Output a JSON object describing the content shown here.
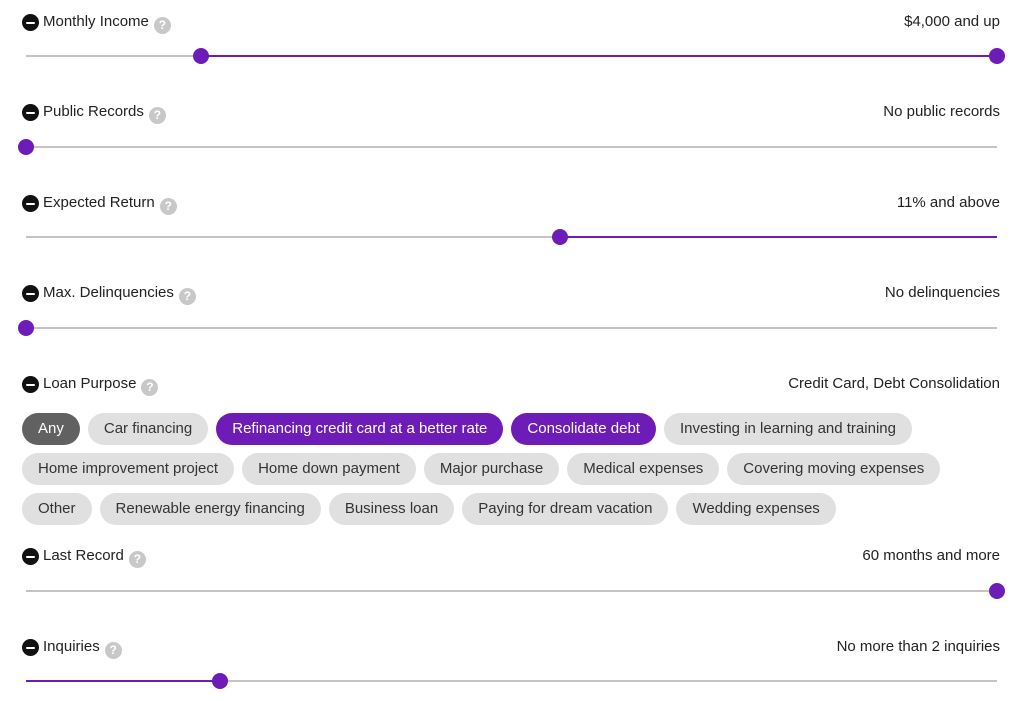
{
  "filters": {
    "monthly_income": {
      "label": "Monthly Income",
      "value": "$4,000 and up",
      "range": [
        0.18,
        1.0
      ]
    },
    "public_records": {
      "label": "Public Records",
      "value": "No public records",
      "range": [
        0.0,
        0.0
      ]
    },
    "expected_return": {
      "label": "Expected Return",
      "value": "11% and above",
      "range": [
        0.55,
        1.0
      ]
    },
    "max_delinquencies": {
      "label": "Max. Delinquencies",
      "value": "No delinquencies",
      "range": [
        0.0,
        0.0
      ]
    },
    "loan_purpose": {
      "label": "Loan Purpose",
      "value": "Credit Card, Debt Consolidation"
    },
    "last_record": {
      "label": "Last Record",
      "value": "60 months and more",
      "range": [
        1.0,
        1.0
      ]
    },
    "inquiries": {
      "label": "Inquiries",
      "value": "No more than 2 inquiries",
      "range": [
        0.0,
        0.2
      ]
    }
  },
  "help_glyph": "?",
  "chips": [
    [
      "Any",
      "Car financing",
      "Refinancing credit card at a better rate",
      "Consolidate debt",
      "Investing in learning and training"
    ],
    [
      "Home improvement project",
      "Home down payment",
      "Major purchase",
      "Medical expenses",
      "Covering moving expenses"
    ],
    [
      "Other",
      "Renewable energy financing",
      "Business loan",
      "Paying for dream vacation",
      "Wedding expenses"
    ]
  ],
  "selected_chips": [
    "Refinancing credit card at a better rate",
    "Consolidate debt"
  ],
  "colors": {
    "accent": "#6e1cb8",
    "track": "#c4c4c4",
    "chip": "#e0e0e0",
    "chip_any": "#616161"
  }
}
